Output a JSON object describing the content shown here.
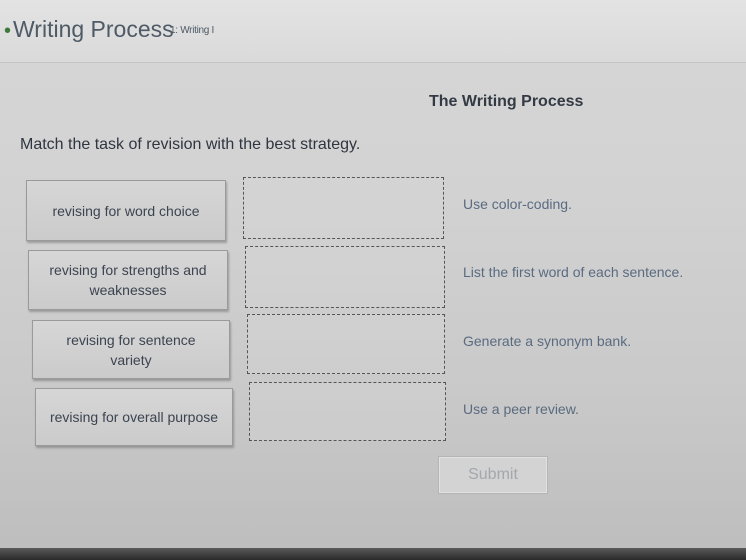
{
  "header": {
    "title": "Writing Process",
    "subtitle": "1: Writing I"
  },
  "activity": {
    "section_title": "The Writing Process",
    "instruction": "Match the task of revision with the best strategy.",
    "tasks": [
      "revising for word choice",
      "revising for strengths and weaknesses",
      "revising for sentence variety",
      "revising for overall purpose"
    ],
    "strategies": [
      "Use color-coding.",
      "List the first word of each sentence.",
      "Generate a synonym bank.",
      "Use a peer review."
    ],
    "submit_label": "Submit"
  }
}
